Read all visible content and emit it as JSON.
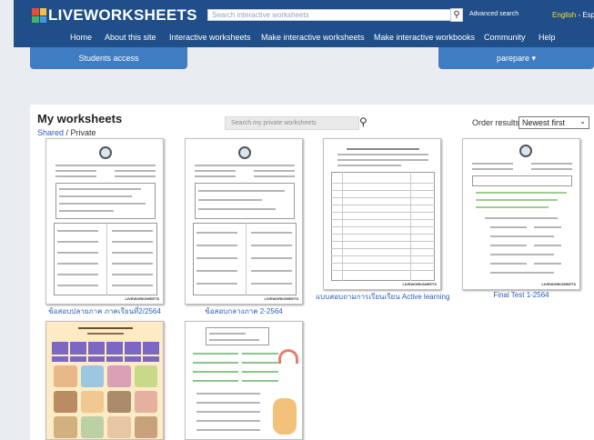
{
  "header": {
    "logo_text": "LIVEWORKSHEETS",
    "search_placeholder": "Search interactive worksheets",
    "advanced_search": "Advanced search",
    "lang_english": "English",
    "lang_spanish": "Españo",
    "nav": [
      "Home",
      "About this site",
      "Interactive worksheets",
      "Make interactive worksheets",
      "Make interactive workbooks",
      "Community",
      "Help"
    ]
  },
  "tabs": {
    "students": "Students access",
    "user": "parepare ▾"
  },
  "main": {
    "title": "My worksheets",
    "filter_shared": "Shared",
    "filter_sep": " / ",
    "filter_private": "Private",
    "search_placeholder": "Search my private worksheets",
    "order_label": "Order results:",
    "order_value": "Newest first",
    "brand": "LIVEWORKSHEETS"
  },
  "worksheets": [
    {
      "title": "ข้อสอบปลายภาค ภาคเรียนที่2/2564"
    },
    {
      "title": "ข้อสอบกลางภาค 2-2564"
    },
    {
      "title": "แบบสอบถามการเรียนเรียน Active learning"
    },
    {
      "title": "Final Test 1-2564"
    },
    {
      "title": ""
    },
    {
      "title": ""
    }
  ],
  "colors": {
    "header_bg": "#1f4e88",
    "tab_bg": "#3f7cc1",
    "link": "#2a5fb3",
    "lang": "#ffde3a",
    "page_bg": "#e9edf2"
  }
}
